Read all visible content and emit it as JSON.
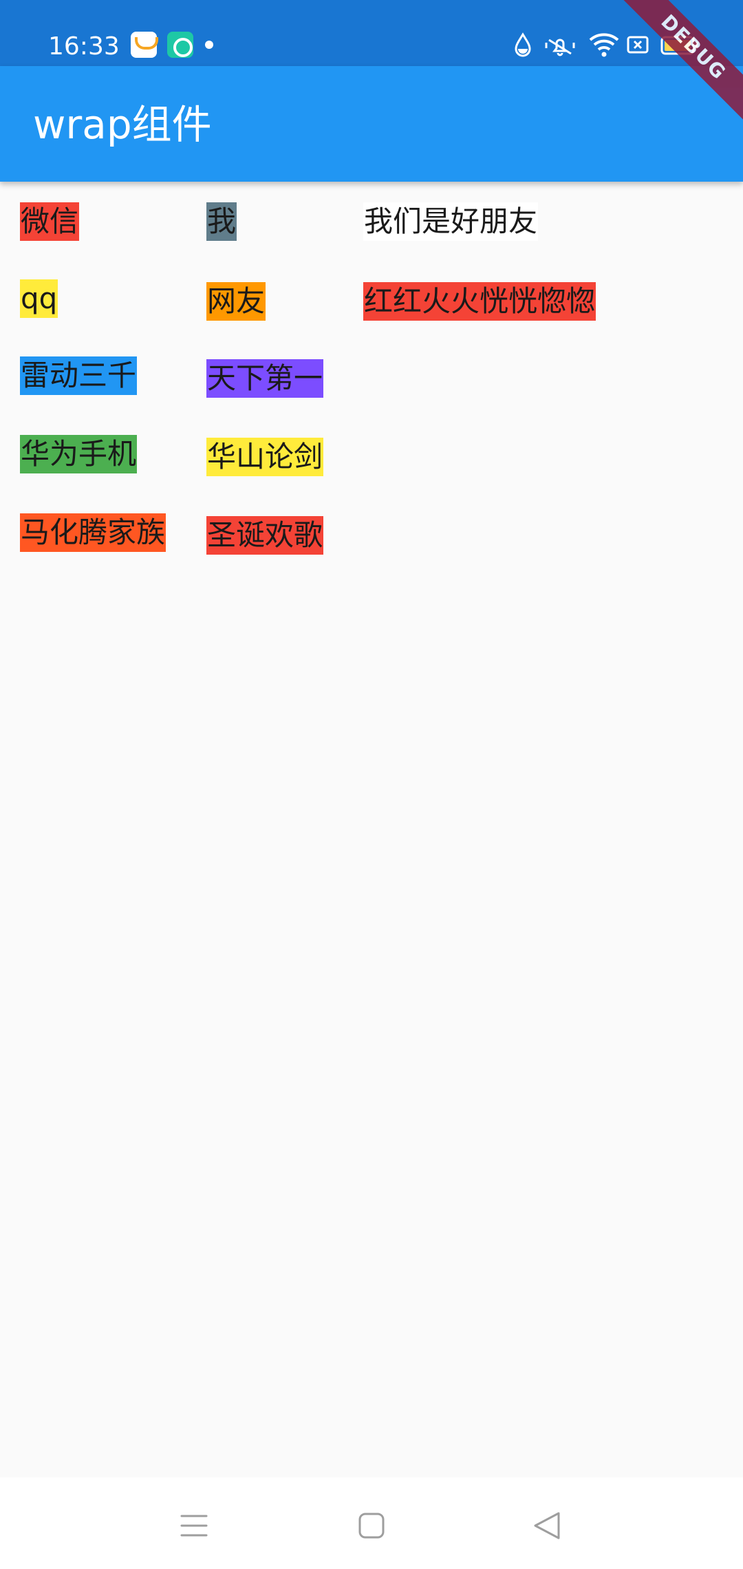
{
  "status_bar": {
    "time": "16:33",
    "icons": [
      "store-icon",
      "green-app-icon",
      "notification-dot",
      "water-drop-icon",
      "mute-icon",
      "wifi-icon",
      "sim-icon",
      "battery-icon"
    ],
    "background": "#1976d2"
  },
  "debug_banner": "DEBUG",
  "app_bar": {
    "title": "wrap组件",
    "background": "#2196f3"
  },
  "chips": [
    {
      "label": "微信",
      "color": "#f44336"
    },
    {
      "label": "我",
      "color": "#607d8b"
    },
    {
      "label": "我们是好朋友",
      "color": "#ffffff"
    },
    {
      "label": "qq",
      "color": "#ffeb3b"
    },
    {
      "label": "网友",
      "color": "#ff9800"
    },
    {
      "label": "红红火火恍恍惚惚",
      "color": "#f44336"
    },
    {
      "label": "雷动三千",
      "color": "#2196f3"
    },
    {
      "label": "天下第一",
      "color": "#7c4dff"
    },
    {
      "label": "华为手机",
      "color": "#4caf50"
    },
    {
      "label": "华山论剑",
      "color": "#ffeb3b"
    },
    {
      "label": "马化腾家族",
      "color": "#ff5722"
    },
    {
      "label": "圣诞欢歌",
      "color": "#f44336"
    }
  ],
  "nav_bar": {
    "buttons": [
      "menu-icon",
      "home-icon",
      "back-icon"
    ]
  }
}
